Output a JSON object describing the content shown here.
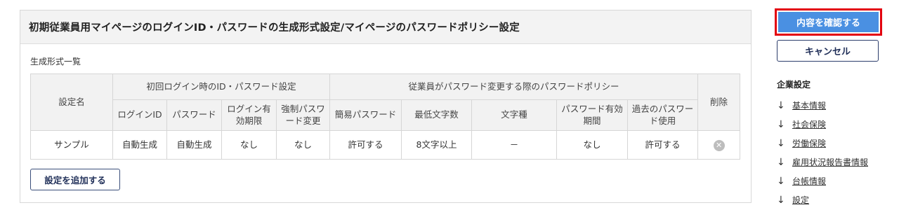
{
  "panel": {
    "title": "初期従業員用マイページのログインID・パスワードの生成形式設定/マイページのパスワードポリシー設定",
    "section_label": "生成形式一覧"
  },
  "table": {
    "col_setting_name": "設定名",
    "group_login": "初回ログイン時のID・パスワード設定",
    "group_policy": "従業員がパスワード変更する際のパスワードポリシー",
    "col_delete": "削除",
    "sub_headers": [
      "ログインID",
      "パスワード",
      "ログイン有効期限",
      "強制パスワード変更",
      "簡易パスワード",
      "最低文字数",
      "文字種",
      "パスワード有効期間",
      "過去のパスワード使用"
    ],
    "row": [
      "サンプル",
      "自動生成",
      "自動生成",
      "なし",
      "なし",
      "許可する",
      "8文字以上",
      "－",
      "なし",
      "許可する"
    ],
    "delete_icon": "close-circle-icon"
  },
  "actions": {
    "add_label": "設定を追加する",
    "confirm_label": "内容を確認する",
    "cancel_label": "キャンセル"
  },
  "side_nav": {
    "heading": "企業設定",
    "items": [
      "基本情報",
      "社会保険",
      "労働保険",
      "雇用状況報告書情報",
      "台帳情報",
      "設定"
    ]
  },
  "colors": {
    "primary": "#4a90e2",
    "highlight_border": "#e3000f",
    "navy": "#2c3d6b"
  }
}
